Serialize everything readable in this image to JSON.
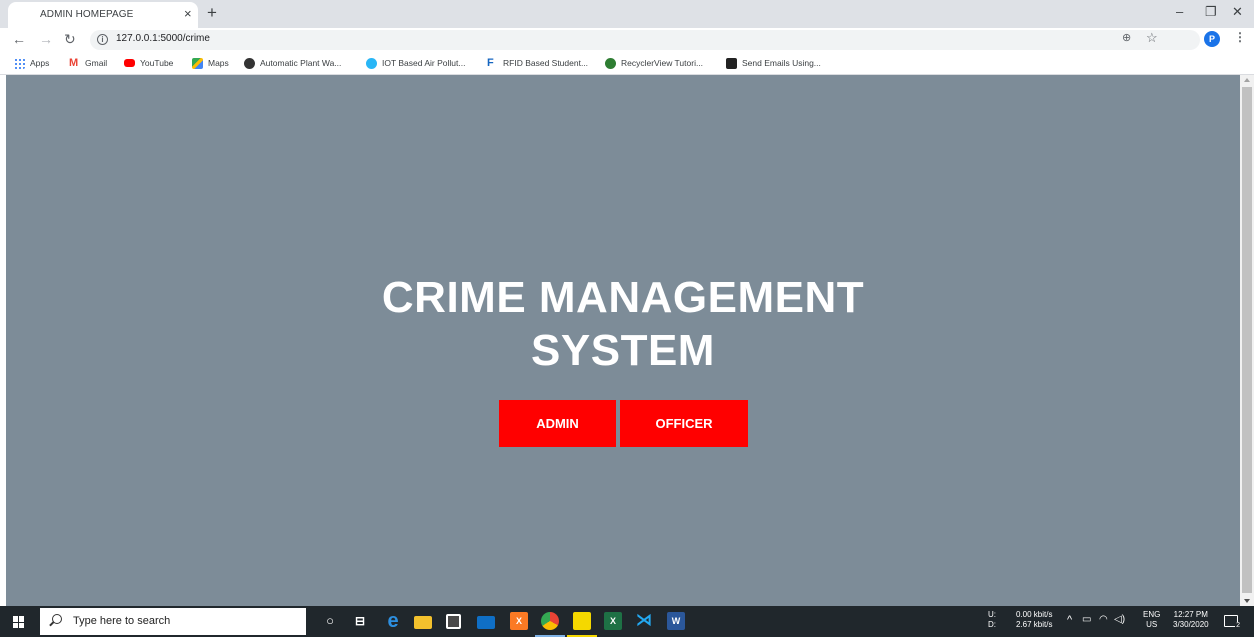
{
  "browser": {
    "tab_title": "ADMIN HOMEPAGE",
    "tab_close": "×",
    "new_tab": "+",
    "url": "127.0.0.1:5000/crime",
    "profile_initial": "P",
    "window_controls": {
      "minimize": "–",
      "restore": "❐",
      "close": "✕"
    }
  },
  "bookmarks": [
    {
      "label": "Apps",
      "icon": "apps-grid-icon",
      "color": "#4285f4"
    },
    {
      "label": "Gmail",
      "icon": "gmail-icon",
      "color": "#ea4335"
    },
    {
      "label": "YouTube",
      "icon": "youtube-icon",
      "color": "#ff0000"
    },
    {
      "label": "Maps",
      "icon": "maps-icon",
      "color": "#34a853"
    },
    {
      "label": "Automatic Plant Wa...",
      "icon": "instructables-icon",
      "color": "#333333"
    },
    {
      "label": "IOT Based Air Pollut...",
      "icon": "globe-icon",
      "color": "#29b6f6"
    },
    {
      "label": "RFID Based Student...",
      "icon": "f-logo-icon",
      "color": "#1565c0"
    },
    {
      "label": "RecyclerView Tutori...",
      "icon": "android-icon",
      "color": "#2e7d32"
    },
    {
      "label": "Send Emails Using...",
      "icon": "laravel-icon",
      "color": "#222222"
    }
  ],
  "page": {
    "title_line1": "CRIME MANAGEMENT",
    "title_line2": "SYSTEM",
    "admin_button": "ADMIN",
    "officer_button": "OFFICER",
    "background_color": "#7d8c98",
    "button_color": "#ff0000"
  },
  "taskbar": {
    "search_placeholder": "Type here to search",
    "network_upload_label": "U:",
    "network_download_label": "D:",
    "upload_speed": "0.00 kbit/s",
    "download_speed": "2.67 kbit/s",
    "language": "ENG",
    "locale": "US",
    "time": "12:27 PM",
    "date": "3/30/2020",
    "notifications": "2"
  }
}
